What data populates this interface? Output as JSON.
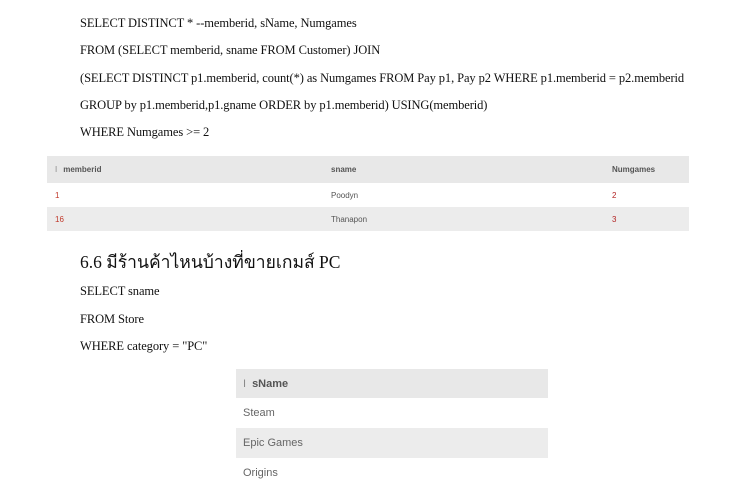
{
  "query1": {
    "lines": [
      "SELECT DISTINCT * --memberid, sName, Numgames",
      "FROM (SELECT memberid, sname FROM Customer) JOIN",
      "(SELECT DISTINCT p1.memberid, count(*) as Numgames FROM Pay p1, Pay p2 WHERE p1.memberid = p2.memberid",
      "GROUP by p1.memberid,p1.gname ORDER by p1.memberid) USING(memberid)",
      "WHERE Numgames >= 2"
    ]
  },
  "table1": {
    "sort_marker": "I",
    "headers": [
      "memberid",
      "sname",
      "Numgames"
    ],
    "rows": [
      [
        "1",
        "Poodyn",
        "2"
      ],
      [
        "16",
        "Thanapon",
        "3"
      ]
    ]
  },
  "section": {
    "heading": "6.6 มีร้านค้าไหนบ้างที่ขายเกมส์ PC"
  },
  "query2": {
    "lines": [
      "SELECT sname",
      "FROM Store",
      "WHERE category = \"PC\""
    ]
  },
  "table2": {
    "sort_marker": "I",
    "header": "sName",
    "rows": [
      "Steam",
      "Epic Games",
      "Origins"
    ]
  }
}
